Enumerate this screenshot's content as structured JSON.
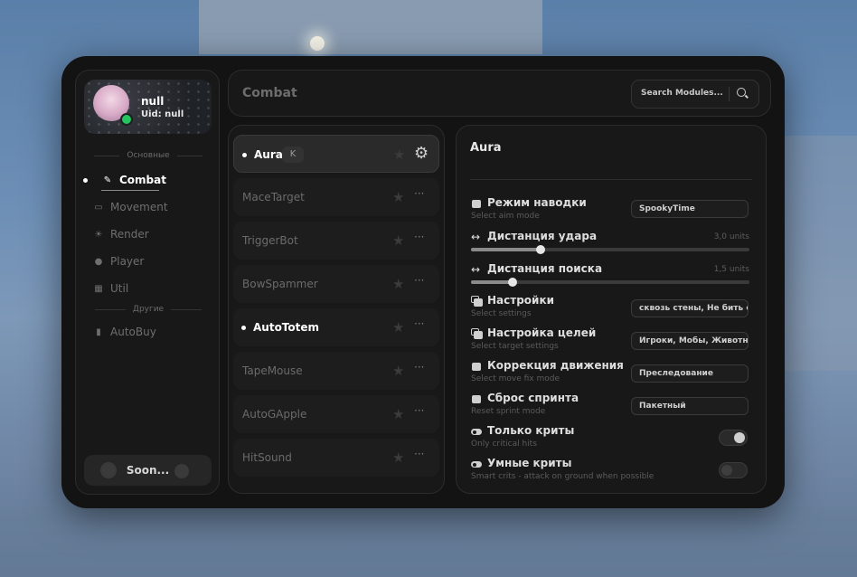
{
  "profile": {
    "name": "null",
    "uid": "Uid: null"
  },
  "sidebar": {
    "section_main": "Основные",
    "section_other": "Другие",
    "items": [
      {
        "label": "Combat",
        "icon": "sword-icon"
      },
      {
        "label": "Movement",
        "icon": "keyboard-icon"
      },
      {
        "label": "Render",
        "icon": "sun-icon"
      },
      {
        "label": "Player",
        "icon": "user-icon"
      },
      {
        "label": "Util",
        "icon": "grid-icon"
      },
      {
        "label": "AutoBuy",
        "icon": "bag-icon"
      }
    ],
    "soon_label": "Soon..."
  },
  "header": {
    "title": "Combat",
    "search_placeholder": "Search Modules..."
  },
  "modules": [
    {
      "name": "Aura",
      "key": "K",
      "enabled": true,
      "selected": true
    },
    {
      "name": "MaceTarget",
      "enabled": false
    },
    {
      "name": "TriggerBot",
      "enabled": false
    },
    {
      "name": "BowSpammer",
      "enabled": false
    },
    {
      "name": "AutoTotem",
      "enabled": true
    },
    {
      "name": "TapeMouse",
      "enabled": false
    },
    {
      "name": "AutoGApple",
      "enabled": false
    },
    {
      "name": "HitSound",
      "enabled": false
    }
  ],
  "settings": {
    "title": "Aura",
    "aim_mode": {
      "label": "Режим наводки",
      "desc": "Select aim mode",
      "value": "SpookyTime"
    },
    "hit_distance": {
      "label": "Дистанция удара",
      "value": "3,0 units",
      "fraction": 0.25
    },
    "search_distance": {
      "label": "Дистанция поиска",
      "value": "1,5 units",
      "fraction": 0.15
    },
    "options": {
      "label": "Настройки",
      "desc": "Select settings",
      "value": "сквозь стены, Не бить если ест"
    },
    "targets": {
      "label": "Настройка целей",
      "desc": "Select target settings",
      "value": "Игроки, Мобы, Животные"
    },
    "move_fix": {
      "label": "Коррекция движения",
      "desc": "Select move fix mode",
      "value": "Преследование"
    },
    "sprint_reset": {
      "label": "Сброс спринта",
      "desc": "Reset sprint mode",
      "value": "Пакетный"
    },
    "only_crits": {
      "label": "Только криты",
      "desc": "Only critical hits",
      "on": true
    },
    "smart_crits": {
      "label": "Умные криты",
      "desc": "Smart crits - attack on ground when possible",
      "on": false
    }
  }
}
